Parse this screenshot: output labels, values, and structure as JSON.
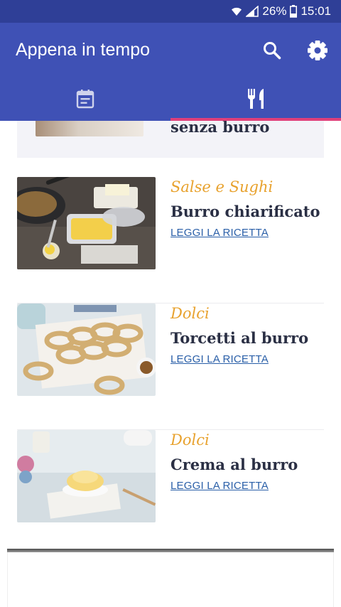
{
  "status_bar": {
    "battery": "26%",
    "time": "15:01"
  },
  "app_bar": {
    "title": "Appena in tempo"
  },
  "tabs": [
    {
      "icon": "calendar-icon",
      "selected": false
    },
    {
      "icon": "fork-knife-icon",
      "selected": true
    }
  ],
  "colors": {
    "primary": "#3f51b5",
    "status_bar": "#2f3f97",
    "accent": "#e0407a",
    "category": "#e8a22e",
    "link": "#2a5fa8",
    "title": "#2a2f44"
  },
  "recipes": {
    "partial_title": "senza burro",
    "items": [
      {
        "category": "Salse e Sughi",
        "title": "Burro chiarificato",
        "link": "LEGGI LA RICETTA",
        "image": "clarified-butter-photo"
      },
      {
        "category": "Dolci",
        "title": "Torcetti al burro",
        "link": "LEGGI LA RICETTA",
        "image": "torcetti-photo"
      },
      {
        "category": "Dolci",
        "title": "Crema al burro",
        "link": "LEGGI LA RICETTA",
        "image": "butter-cream-photo"
      }
    ]
  }
}
